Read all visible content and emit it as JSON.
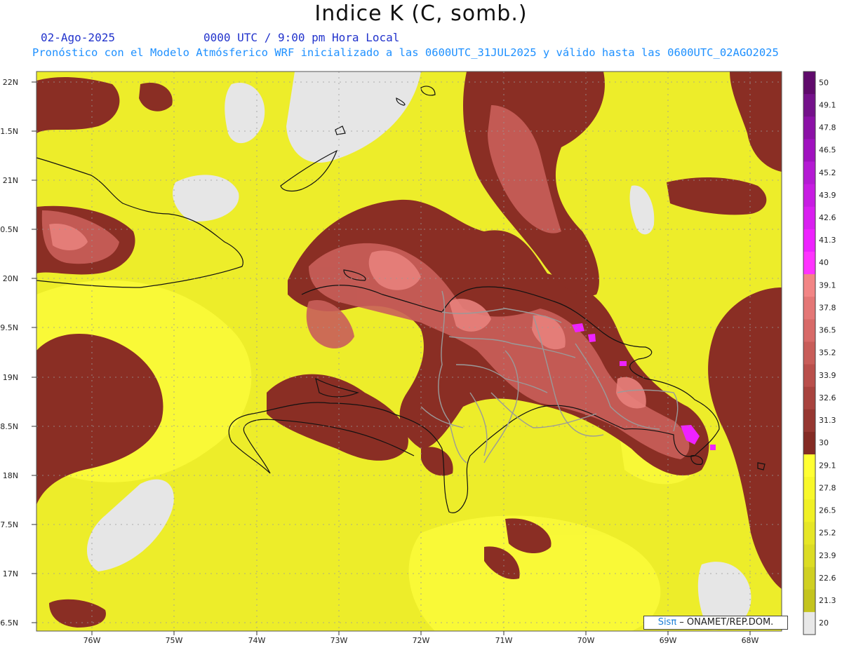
{
  "header": {
    "title": "Indice K (C, somb.)",
    "date": "02-Ago-2025",
    "time": "0000 UTC / 9:00 pm Hora Local",
    "init_line": "Pronóstico con el Modelo Atmósferico WRF inicializado a las 0600UTC_31JUL2025 y válido hasta las  0600UTC_02AGO2025"
  },
  "map": {
    "lat_labels": [
      "22N",
      "21.5N",
      "21N",
      "20.5N",
      "20N",
      "19.5N",
      "19N",
      "18.5N",
      "18N",
      "17.5N",
      "17N",
      "16.5N"
    ],
    "lon_labels": [
      "76W",
      "75W",
      "74W",
      "73W",
      "72W",
      "71W",
      "70W",
      "69W",
      "68W"
    ]
  },
  "colorbar": {
    "labels": [
      "50",
      "49.1",
      "47.8",
      "46.5",
      "45.2",
      "43.9",
      "42.6",
      "41.3",
      "40",
      "39.1",
      "37.8",
      "36.5",
      "35.2",
      "33.9",
      "32.6",
      "31.3",
      "30",
      "29.1",
      "27.8",
      "26.5",
      "25.2",
      "23.9",
      "22.6",
      "21.3",
      "20"
    ],
    "colors": [
      "#5f0a6b",
      "#74118a",
      "#8b11a6",
      "#a012bf",
      "#b41ad3",
      "#c71ce2",
      "#d91ff0",
      "#ee22ff",
      "#ff33ff",
      "#f28585",
      "#e47776",
      "#d86a68",
      "#c85d59",
      "#b94f4b",
      "#a8433e",
      "#963731",
      "#842b24",
      "#ffff33",
      "#f8f82a",
      "#f0f025",
      "#e6e626",
      "#dcdc24",
      "#d0d022",
      "#c4c41e",
      "#e8e8e8"
    ]
  },
  "credit": {
    "sis": "Sisπ",
    "text": " – ONAMET/REP.DOM."
  }
}
